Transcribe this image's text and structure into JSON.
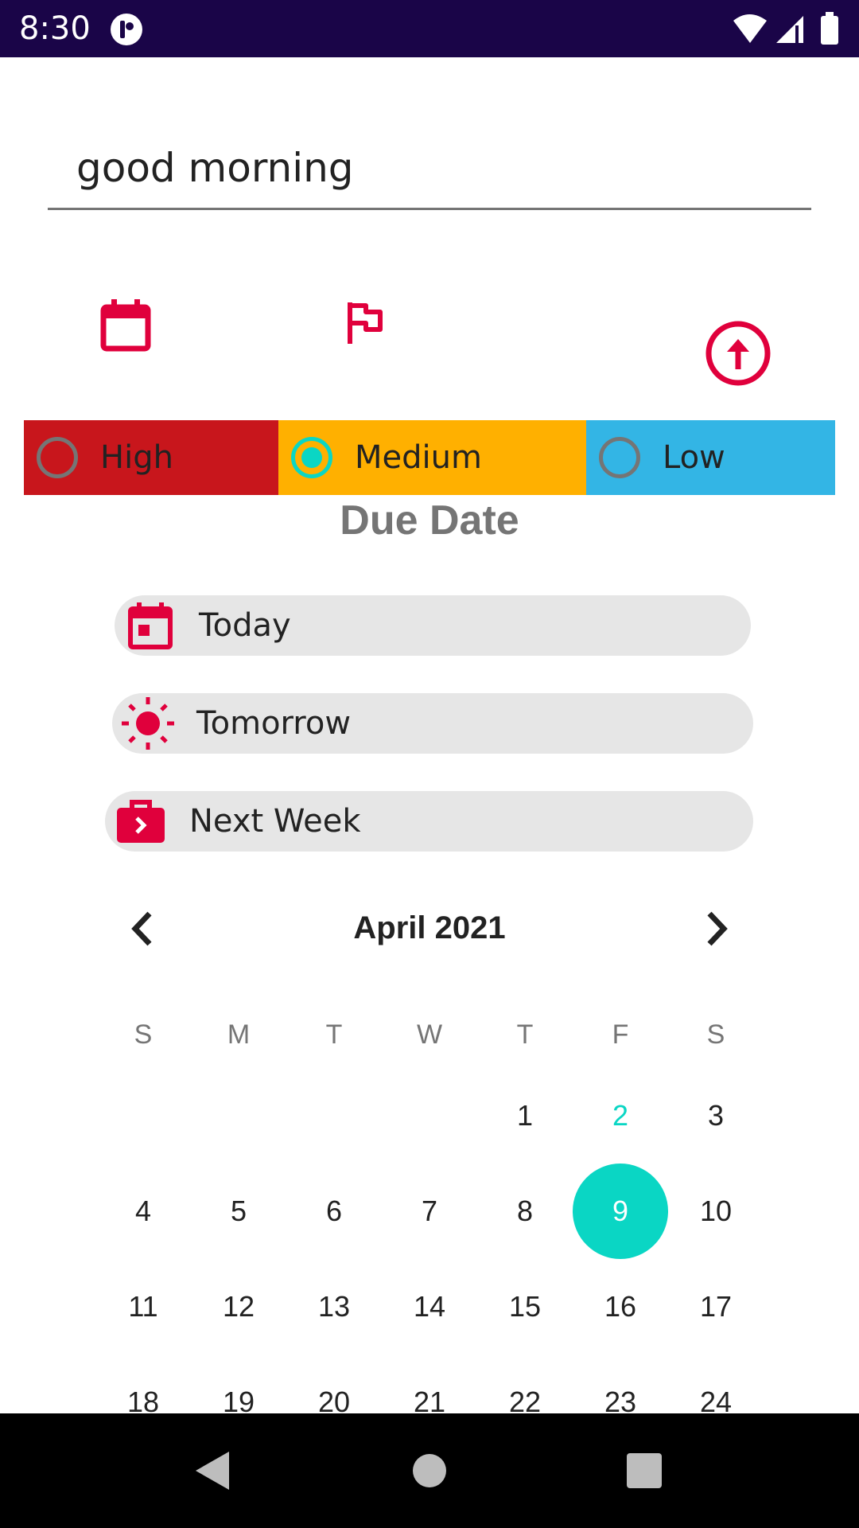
{
  "status_bar": {
    "time": "8:30"
  },
  "task": {
    "title_value": "good morning"
  },
  "priority": {
    "options": [
      {
        "label": "High",
        "color": "#c8161c",
        "checked": false
      },
      {
        "label": "Medium",
        "color": "#ffb000",
        "checked": true
      },
      {
        "label": "Low",
        "color": "#33b5e5",
        "checked": false
      }
    ]
  },
  "due_date": {
    "heading": "Due Date",
    "chips": [
      {
        "label": "Today",
        "icon": "calendar-today-icon"
      },
      {
        "label": "Tomorrow",
        "icon": "sun-icon"
      },
      {
        "label": "Next Week",
        "icon": "briefcase-arrow-icon"
      }
    ]
  },
  "calendar": {
    "month_label": "April 2021",
    "weekdays": [
      "S",
      "M",
      "T",
      "W",
      "T",
      "F",
      "S"
    ],
    "weeks": [
      [
        "",
        "",
        "",
        "",
        "1",
        "2",
        "3"
      ],
      [
        "4",
        "5",
        "6",
        "7",
        "8",
        "9",
        "10"
      ],
      [
        "11",
        "12",
        "13",
        "14",
        "15",
        "16",
        "17"
      ],
      [
        "18",
        "19",
        "20",
        "21",
        "22",
        "23",
        "24"
      ]
    ],
    "today": "2",
    "selected": "9"
  },
  "colors": {
    "accent": "#e0003c",
    "teal": "#0ad6c4",
    "status_bar": "#1a0548"
  }
}
